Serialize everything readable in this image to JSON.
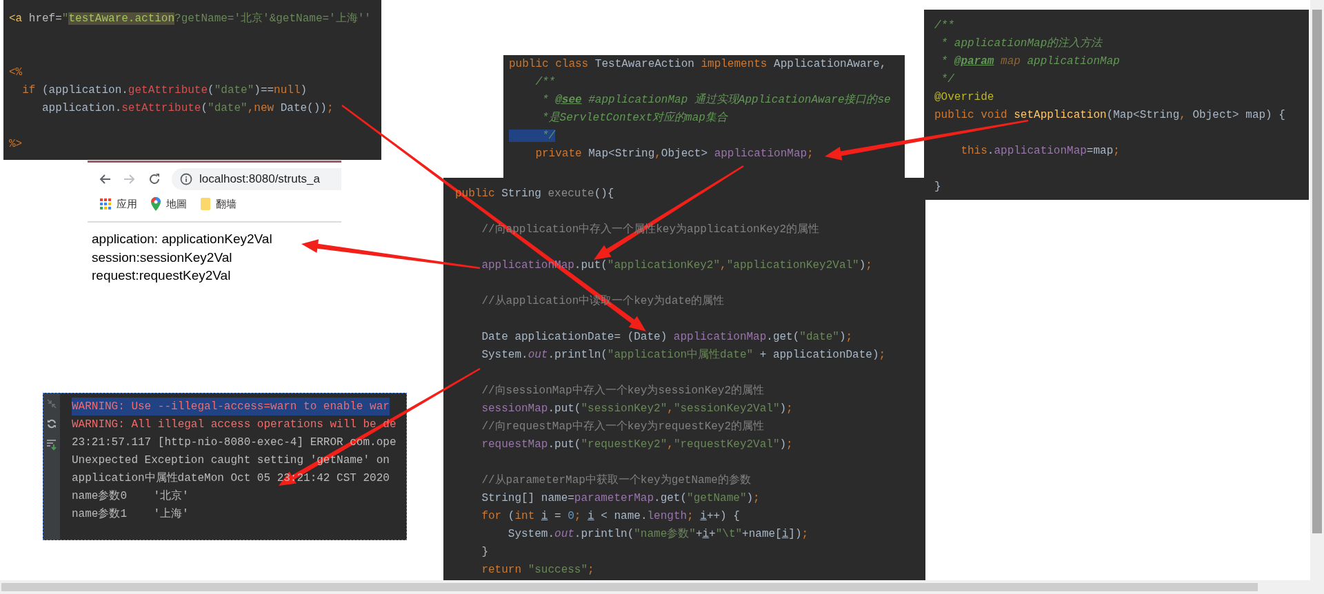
{
  "jsp_snippet": {
    "lines": [
      {
        "kind": "code",
        "segments": [
          {
            "t": "<a",
            "kind": "tag"
          },
          {
            "t": " href=",
            "kind": "attr"
          },
          {
            "t": "\"",
            "kind": "str"
          },
          {
            "t": "testAware.action",
            "kind": "str-hl"
          },
          {
            "t": "?getName='北京'&getName='上海''",
            "kind": "str"
          }
        ]
      },
      {
        "kind": "blank"
      },
      {
        "kind": "blank"
      },
      {
        "kind": "code",
        "segments": [
          {
            "t": "<%",
            "kind": "jsp"
          }
        ]
      },
      {
        "kind": "code",
        "segments": [
          {
            "t": "  if ",
            "kind": "kw"
          },
          {
            "t": "(application.",
            "kind": "plain"
          },
          {
            "t": "getAttribute",
            "kind": "jspm"
          },
          {
            "t": "(",
            "kind": "plain"
          },
          {
            "t": "\"date\"",
            "kind": "str"
          },
          {
            "t": ")==",
            "kind": "plain"
          },
          {
            "t": "null",
            "kind": "kw"
          },
          {
            "t": ")",
            "kind": "plain"
          }
        ]
      },
      {
        "kind": "code",
        "segments": [
          {
            "t": "     application.",
            "kind": "plain"
          },
          {
            "t": "setAttribute",
            "kind": "jspm"
          },
          {
            "t": "(",
            "kind": "plain"
          },
          {
            "t": "\"date\"",
            "kind": "str"
          },
          {
            "t": ",new ",
            "kind": "kw"
          },
          {
            "t": "Date())",
            "kind": "plain"
          },
          {
            "t": ";",
            "kind": "kw"
          }
        ]
      },
      {
        "kind": "blank"
      },
      {
        "kind": "code",
        "segments": [
          {
            "t": "%>",
            "kind": "jsp"
          }
        ]
      }
    ]
  },
  "browser": {
    "nav": [
      {
        "kind": "back",
        "disabled": false
      },
      {
        "kind": "forward",
        "disabled": true
      },
      {
        "kind": "reload",
        "disabled": false
      }
    ],
    "address": "localhost:8080/struts_a",
    "bookmarks": [
      {
        "kind": "apps",
        "label": "应用"
      },
      {
        "kind": "maps",
        "label": "地圖"
      },
      {
        "kind": "folder",
        "label": "翻墙"
      }
    ],
    "page_lines": [
      "application: applicationKey2Val",
      "session:sessionKey2Val",
      "request:requestKey2Val"
    ]
  },
  "class_header": {
    "lines": [
      {
        "kind": "code",
        "segments": [
          {
            "t": "public class ",
            "kind": "kw"
          },
          {
            "t": "TestAwareAction ",
            "kind": "plain"
          },
          {
            "t": "implements ",
            "kind": "kw"
          },
          {
            "t": "ApplicationAware,",
            "kind": "plain"
          }
        ]
      },
      {
        "kind": "code",
        "segments": [
          {
            "t": "    /**",
            "kind": "doc"
          }
        ]
      },
      {
        "kind": "code",
        "segments": [
          {
            "t": "     * ",
            "kind": "doc"
          },
          {
            "t": "@see",
            "kind": "doc-tag"
          },
          {
            "t": " #applicationMap 通过实现ApplicationAware接口的se",
            "kind": "doc"
          }
        ]
      },
      {
        "kind": "code",
        "segments": [
          {
            "t": "     *是ServletContext对应的map集合",
            "kind": "doc"
          }
        ]
      },
      {
        "kind": "code",
        "segments": [
          {
            "t": "     */",
            "kind": "doc-sel"
          }
        ]
      },
      {
        "kind": "code",
        "segments": [
          {
            "t": "    private ",
            "kind": "kw"
          },
          {
            "t": "Map<String",
            "kind": "plain"
          },
          {
            "t": ",",
            "kind": "kw"
          },
          {
            "t": "Object> ",
            "kind": "plain"
          },
          {
            "t": "applicationMap",
            "kind": "field"
          },
          {
            "t": ";",
            "kind": "kw"
          }
        ]
      }
    ]
  },
  "setter_method": {
    "lines": [
      {
        "kind": "code",
        "segments": [
          {
            "t": "/**",
            "kind": "doc"
          }
        ]
      },
      {
        "kind": "code",
        "segments": [
          {
            "t": " * applicationMap的注入方法",
            "kind": "doc"
          }
        ]
      },
      {
        "kind": "code",
        "segments": [
          {
            "t": " * ",
            "kind": "doc"
          },
          {
            "t": "@param",
            "kind": "doc-tag"
          },
          {
            "t": " map",
            "kind": "doc-param"
          },
          {
            "t": " applicationMap",
            "kind": "doc"
          }
        ]
      },
      {
        "kind": "code",
        "segments": [
          {
            "t": " */",
            "kind": "doc"
          }
        ]
      },
      {
        "kind": "code",
        "segments": [
          {
            "t": "@Override",
            "kind": "annot"
          }
        ]
      },
      {
        "kind": "code",
        "segments": [
          {
            "t": "public void ",
            "kind": "kw"
          },
          {
            "t": "setApplication",
            "kind": "method-decl"
          },
          {
            "t": "(Map<String",
            "kind": "plain"
          },
          {
            "t": ",",
            "kind": "kw"
          },
          {
            "t": " Object> map) {",
            "kind": "plain"
          }
        ]
      },
      {
        "kind": "blank"
      },
      {
        "kind": "code",
        "segments": [
          {
            "t": "    this",
            "kind": "kw"
          },
          {
            "t": ".",
            "kind": "plain"
          },
          {
            "t": "applicationMap",
            "kind": "field"
          },
          {
            "t": "=map",
            "kind": "plain"
          },
          {
            "t": ";",
            "kind": "kw"
          }
        ]
      },
      {
        "kind": "blank"
      },
      {
        "kind": "code",
        "segments": [
          {
            "t": "}",
            "kind": "plain"
          }
        ]
      }
    ]
  },
  "execute_method": {
    "lines": [
      {
        "kind": "code",
        "segments": [
          {
            "t": "public ",
            "kind": "kw"
          },
          {
            "t": "String ",
            "kind": "plain"
          },
          {
            "t": "execute",
            "kind": "unused"
          },
          {
            "t": "(){",
            "kind": "plain"
          }
        ]
      },
      {
        "kind": "blank"
      },
      {
        "kind": "code",
        "segments": [
          {
            "t": "    //向application中存入一个属性key为applicationKey2的属性",
            "kind": "cmt"
          }
        ]
      },
      {
        "kind": "blank"
      },
      {
        "kind": "code",
        "segments": [
          {
            "t": "    applicationMap",
            "kind": "field"
          },
          {
            "t": ".put(",
            "kind": "plain"
          },
          {
            "t": "\"applicationKey2\"",
            "kind": "str"
          },
          {
            "t": ",",
            "kind": "kw"
          },
          {
            "t": "\"applicationKey2Val\"",
            "kind": "str"
          },
          {
            "t": ")",
            "kind": "plain"
          },
          {
            "t": ";",
            "kind": "kw"
          }
        ]
      },
      {
        "kind": "blank"
      },
      {
        "kind": "code",
        "segments": [
          {
            "t": "    //从application中读取一个key为date的属性",
            "kind": "cmt"
          }
        ]
      },
      {
        "kind": "blank"
      },
      {
        "kind": "code",
        "segments": [
          {
            "t": "    Date applicationDate= (Date) ",
            "kind": "plain"
          },
          {
            "t": "applicationMap",
            "kind": "field"
          },
          {
            "t": ".get(",
            "kind": "plain"
          },
          {
            "t": "\"date\"",
            "kind": "str"
          },
          {
            "t": ")",
            "kind": "plain"
          },
          {
            "t": ";",
            "kind": "kw"
          }
        ]
      },
      {
        "kind": "code",
        "segments": [
          {
            "t": "    System.",
            "kind": "plain"
          },
          {
            "t": "out",
            "kind": "static"
          },
          {
            "t": ".println(",
            "kind": "plain"
          },
          {
            "t": "\"application中属性date\"",
            "kind": "str"
          },
          {
            "t": " + applicationDate)",
            "kind": "plain"
          },
          {
            "t": ";",
            "kind": "kw"
          }
        ]
      },
      {
        "kind": "blank"
      },
      {
        "kind": "code",
        "segments": [
          {
            "t": "    //向sessionMap中存入一个key为sessionKey2的属性",
            "kind": "cmt"
          }
        ]
      },
      {
        "kind": "code",
        "segments": [
          {
            "t": "    sessionMap",
            "kind": "field"
          },
          {
            "t": ".put(",
            "kind": "plain"
          },
          {
            "t": "\"sessionKey2\"",
            "kind": "str"
          },
          {
            "t": ",",
            "kind": "kw"
          },
          {
            "t": "\"sessionKey2Val\"",
            "kind": "str"
          },
          {
            "t": ")",
            "kind": "plain"
          },
          {
            "t": ";",
            "kind": "kw"
          }
        ]
      },
      {
        "kind": "code",
        "segments": [
          {
            "t": "    //向requestMap中存入一个key为requestKey2的属性",
            "kind": "cmt"
          }
        ]
      },
      {
        "kind": "code",
        "segments": [
          {
            "t": "    requestMap",
            "kind": "field"
          },
          {
            "t": ".put(",
            "kind": "plain"
          },
          {
            "t": "\"requestKey2\"",
            "kind": "str"
          },
          {
            "t": ",",
            "kind": "kw"
          },
          {
            "t": "\"requestKey2Val\"",
            "kind": "str"
          },
          {
            "t": ")",
            "kind": "plain"
          },
          {
            "t": ";",
            "kind": "kw"
          }
        ]
      },
      {
        "kind": "blank"
      },
      {
        "kind": "code",
        "segments": [
          {
            "t": "    //从parameterMap中获取一个key为getName的参数",
            "kind": "cmt"
          }
        ]
      },
      {
        "kind": "code",
        "segments": [
          {
            "t": "    String[] name=",
            "kind": "plain"
          },
          {
            "t": "parameterMap",
            "kind": "field"
          },
          {
            "t": ".get(",
            "kind": "plain"
          },
          {
            "t": "\"getName\"",
            "kind": "str"
          },
          {
            "t": ")",
            "kind": "plain"
          },
          {
            "t": ";",
            "kind": "kw"
          }
        ]
      },
      {
        "kind": "code",
        "segments": [
          {
            "t": "    for ",
            "kind": "kw"
          },
          {
            "t": "(",
            "kind": "plain"
          },
          {
            "t": "int ",
            "kind": "kw"
          },
          {
            "t": "i",
            "kind": "var-u"
          },
          {
            "t": " = ",
            "kind": "plain"
          },
          {
            "t": "0",
            "kind": "num"
          },
          {
            "t": "; ",
            "kind": "kw"
          },
          {
            "t": "i",
            "kind": "var-u"
          },
          {
            "t": " < name.",
            "kind": "plain"
          },
          {
            "t": "length",
            "kind": "field"
          },
          {
            "t": "; ",
            "kind": "kw"
          },
          {
            "t": "i",
            "kind": "var-u"
          },
          {
            "t": "++) {",
            "kind": "plain"
          }
        ]
      },
      {
        "kind": "code",
        "segments": [
          {
            "t": "        System.",
            "kind": "plain"
          },
          {
            "t": "out",
            "kind": "static"
          },
          {
            "t": ".println(",
            "kind": "plain"
          },
          {
            "t": "\"name参数\"",
            "kind": "str"
          },
          {
            "t": "+",
            "kind": "plain"
          },
          {
            "t": "i",
            "kind": "var-u"
          },
          {
            "t": "+",
            "kind": "plain"
          },
          {
            "t": "\"\\t\"",
            "kind": "str"
          },
          {
            "t": "+name[",
            "kind": "plain"
          },
          {
            "t": "i",
            "kind": "var-u"
          },
          {
            "t": "])",
            "kind": "plain"
          },
          {
            "t": ";",
            "kind": "kw"
          }
        ]
      },
      {
        "kind": "code",
        "segments": [
          {
            "t": "    }",
            "kind": "plain"
          }
        ]
      },
      {
        "kind": "code",
        "segments": [
          {
            "t": "    return ",
            "kind": "kw"
          },
          {
            "t": "\"success\"",
            "kind": "str"
          },
          {
            "t": ";",
            "kind": "kw"
          }
        ]
      }
    ]
  },
  "console": {
    "lines": [
      {
        "text": "WARNING: Use --illegal-access=warn to enable war",
        "kind": "warning",
        "selected": true
      },
      {
        "text": "WARNING: All illegal access operations will be de",
        "kind": "warning",
        "selected": false
      },
      {
        "text": "23:21:57.117 [http-nio-8080-exec-4] ERROR com.ope",
        "kind": "normal",
        "selected": false
      },
      {
        "text": "Unexpected Exception caught setting 'getName' on",
        "kind": "normal",
        "selected": false
      },
      {
        "text": "application中属性dateMon Oct 05 23:21:42 CST 2020",
        "kind": "normal",
        "selected": false
      },
      {
        "text": "name参数0    '北京'",
        "kind": "normal",
        "selected": false
      },
      {
        "text": "name参数1    '上海'",
        "kind": "normal",
        "selected": false
      }
    ]
  }
}
